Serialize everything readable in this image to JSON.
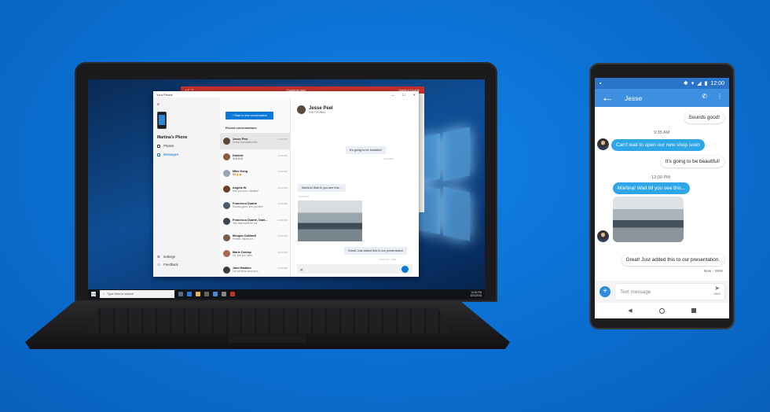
{
  "laptop": {
    "bg_window": {
      "title": "Quarterly.pptx",
      "user": "Martina Duarte"
    },
    "app": {
      "title": "Your Phone",
      "phone_name": "Martina's Phone",
      "nav": [
        {
          "label": "Photos"
        },
        {
          "label": "Messages"
        }
      ],
      "nav_bottom": [
        {
          "label": "Settings"
        },
        {
          "label": "Feedback"
        }
      ],
      "new_conversation": "+  Start a new conversation",
      "recent_label": "Recent conversations",
      "conversations": [
        {
          "name": "Jesse Peel",
          "preview": "Great! Just added this...",
          "time": "12:00 PM",
          "color": "#5b4638"
        },
        {
          "name": "Daniela",
          "preview": "😄😄😄😄",
          "time": "12:00 PM",
          "color": "#8a5a3a"
        },
        {
          "name": "Mike Kong",
          "preview": "🐶👍🎉",
          "time": "12:00 PM",
          "color": "#9aa5b1"
        },
        {
          "name": "Angela W",
          "preview": "See you soon, Martina!",
          "time": "12:00 PM",
          "color": "#6b3f2e"
        },
        {
          "name": "Francisco Duarte",
          "preview": "Sounds good, see you then",
          "time": "12:00 PM",
          "color": "#4a5a6a"
        },
        {
          "name": "Francisco Duarte, Dani...",
          "preview": "Yes, that works for me",
          "time": "12:00 PM",
          "color": "#3b4654"
        },
        {
          "name": "Morgan Caldwell",
          "preview": "Perfect, thanks for...",
          "time": "12:00 PM",
          "color": "#7a5c4a"
        },
        {
          "name": "Marie Dunlap",
          "preview": "Ok, see you there",
          "time": "12:00 PM",
          "color": "#a86b52"
        },
        {
          "name": "Jami Hadden",
          "preview": "Let me know what you...",
          "time": "12:00 PM",
          "color": "#3d3d3d"
        }
      ],
      "chat": {
        "name": "Jesse Peel",
        "phone": "206-778-9641",
        "messages": [
          {
            "text": "It's going to be beautiful!",
            "meta": "12:00 PM"
          },
          {
            "text": "Martina! Wait til you see this...",
            "meta": "12:00 PM"
          },
          {
            "text": "Great! Just added this to our presentation",
            "meta": "12:00 PM · SMS"
          }
        ],
        "input_placeholder": "Text message"
      }
    },
    "taskbar": {
      "search_placeholder": "Type here to search",
      "time": "12:00 PM",
      "date": "8/31/2018"
    }
  },
  "phone": {
    "status_time": "12:00",
    "contact": "Jesse",
    "messages": [
      {
        "dir": "out",
        "text": "Sounds good!"
      },
      {
        "dir": "time",
        "text": "9:35 AM"
      },
      {
        "dir": "in",
        "text": "Can't wait to open our new shop soon"
      },
      {
        "dir": "out",
        "text": "It's going to be beautiful!"
      },
      {
        "dir": "time",
        "text": "12:00 PM"
      },
      {
        "dir": "in",
        "text": "Martina! Wait till you see this..."
      },
      {
        "dir": "out",
        "text": "Great! Just added this to our presentation."
      },
      {
        "dir": "meta",
        "text": "Now · SMS"
      }
    ],
    "compose_placeholder": "Text message",
    "send_label": "SMS"
  },
  "colors": {
    "background": "#0a6fd1",
    "accent": "#0a78d7",
    "phone_header": "#3e8fe0",
    "incoming_bubble": "#2ea6e8"
  }
}
